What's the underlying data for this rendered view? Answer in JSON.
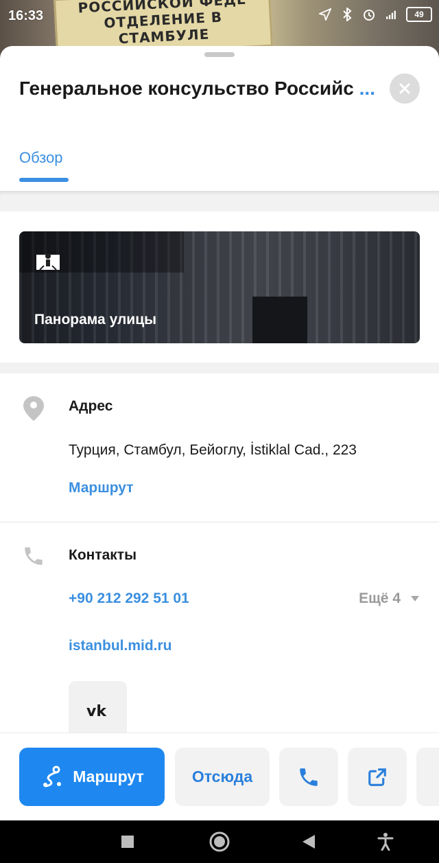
{
  "status": {
    "time": "16:33",
    "battery": "49"
  },
  "background": {
    "sign_line1": "РОССИЙСКОЙ ФЕДЕ",
    "sign_line2": "ОТДЕЛЕНИЕ В СТАМБУЛЕ"
  },
  "card": {
    "title": "Генеральное консульство Российс",
    "title_more": "...",
    "tab_overview": "Обзор",
    "panorama_label": "Панорама улицы"
  },
  "address": {
    "label": "Адрес",
    "value": "Турция, Стамбул, Бейоглу, İstiklal Cad., 223",
    "route_link": "Маршрут"
  },
  "contacts": {
    "label": "Контакты",
    "phone": "+90 212 292 51 01",
    "more": "Ещё 4",
    "website": "istanbul.mid.ru",
    "vk_icon": "vk-icon"
  },
  "actions": {
    "route": "Маршрут",
    "from_here": "Отсюда"
  },
  "colors": {
    "accent": "#1e88f0",
    "link": "#3b8fe0"
  }
}
